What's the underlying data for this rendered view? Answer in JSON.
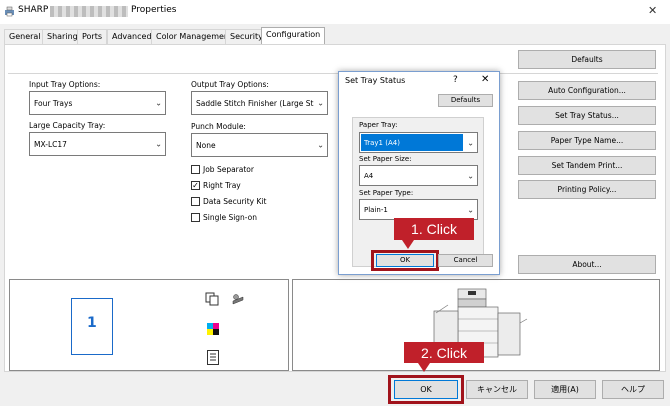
{
  "window": {
    "title_prefix": "SHARP",
    "title_suffix": "Properties",
    "close_glyph": "✕"
  },
  "tabs": [
    {
      "label": "General",
      "active": false
    },
    {
      "label": "Sharing",
      "active": false
    },
    {
      "label": "Ports",
      "active": false
    },
    {
      "label": "Advanced",
      "active": false
    },
    {
      "label": "Color Management",
      "active": false
    },
    {
      "label": "Security",
      "active": false
    },
    {
      "label": "Configuration",
      "active": true
    }
  ],
  "config": {
    "defaults_label": "Defaults",
    "input_tray": {
      "label": "Input Tray Options:",
      "value": "Four Trays"
    },
    "large_capacity_tray": {
      "label": "Large Capacity Tray:",
      "value": "MX-LC17"
    },
    "output_tray": {
      "label": "Output Tray Options:",
      "value": "Saddle Stitch Finisher (Large Stack"
    },
    "punch_module": {
      "label": "Punch Module:",
      "value": "None"
    },
    "checkboxes": [
      {
        "label": "Job Separator",
        "checked": false
      },
      {
        "label": "Right Tray",
        "checked": true
      },
      {
        "label": "Data Security Kit",
        "checked": false
      },
      {
        "label": "Single Sign-on",
        "checked": false
      }
    ],
    "side_buttons": [
      "Auto Configuration...",
      "Set Tray Status...",
      "Paper Type Name...",
      "Set Tandem Print...",
      "Printing Policy..."
    ],
    "about_label": "About...",
    "preview_page_number": "1"
  },
  "dialog": {
    "title": "Set Tray Status",
    "help_glyph": "?",
    "close_glyph": "✕",
    "defaults_label": "Defaults",
    "paper_tray": {
      "label": "Paper Tray:",
      "value": "Tray1 (A4)"
    },
    "paper_size": {
      "label": "Set Paper Size:",
      "value": "A4"
    },
    "paper_type": {
      "label": "Set Paper Type:",
      "value": "Plain-1"
    },
    "ok_label": "OK",
    "cancel_label": "Cancel"
  },
  "callouts": {
    "step1": "1. Click",
    "step2": "2. Click"
  },
  "footer": {
    "ok_label": "OK",
    "cancel_label": "キャンセル",
    "apply_label": "適用(A)",
    "help_label": "ヘルプ"
  },
  "colors": {
    "accent_red": "#c0202a",
    "selected_blue": "#0078d7"
  }
}
